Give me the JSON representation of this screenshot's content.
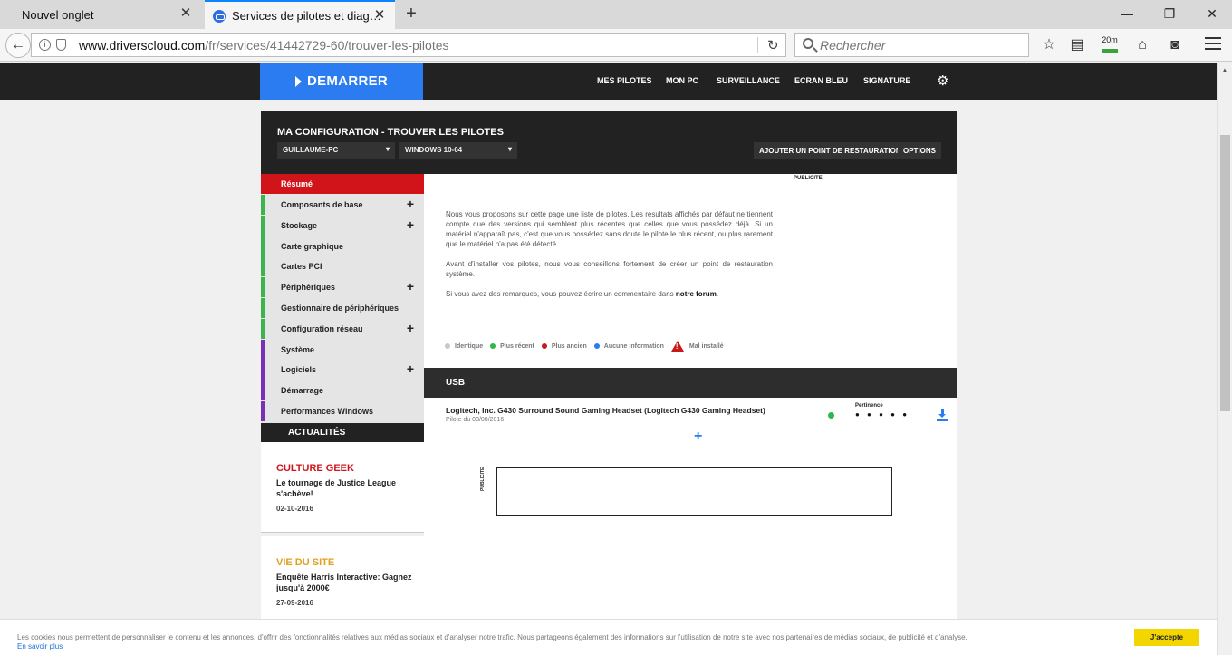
{
  "browser": {
    "tabs": [
      {
        "title": "Nouvel onglet"
      },
      {
        "title": "Services de pilotes et diag…"
      }
    ],
    "new_tab": "+",
    "url_domain": "www.driverscloud.com",
    "url_path": "/fr/services/41442729-60/trouver-les-pilotes",
    "search_placeholder": "Rechercher",
    "timer_badge": "20m"
  },
  "site_nav": {
    "start_label": "DEMARRER",
    "links": [
      "MES PILOTES",
      "MON PC",
      "SURVEILLANCE",
      "ECRAN BLEU",
      "SIGNATURE"
    ]
  },
  "config": {
    "title": "MA CONFIGURATION - TROUVER LES PILOTES",
    "pc_select": "GUILLAUME-PC",
    "os_select": "WINDOWS 10-64",
    "restore_button": "AJOUTER UN POINT DE RESTAURATION",
    "options_button": "OPTIONS"
  },
  "sidebar": {
    "items": [
      {
        "label": "Résumé"
      },
      {
        "label": "Composants de base"
      },
      {
        "label": "Stockage"
      },
      {
        "label": "Carte graphique"
      },
      {
        "label": "Cartes PCI"
      },
      {
        "label": "Périphériques"
      },
      {
        "label": "Gestionnaire de périphériques"
      },
      {
        "label": "Configuration réseau"
      },
      {
        "label": "Système"
      },
      {
        "label": "Logiciels"
      },
      {
        "label": "Démarrage"
      },
      {
        "label": "Performances Windows"
      }
    ],
    "plus": "+"
  },
  "news": {
    "header": "ACTUALITÉS",
    "items": [
      {
        "category": "CULTURE GEEK",
        "title": "Le tournage de Justice League s'achève!",
        "date": "02-10-2016",
        "color": "#d0141a"
      },
      {
        "category": "VIE DU SITE",
        "title": "Enquête Harris Interactive: Gagnez jusqu'à 2000€",
        "date": "27-09-2016",
        "color": "#e0a020"
      }
    ]
  },
  "main": {
    "pub_label": "PUBLICITE",
    "intro_1": "Nous vous proposons sur cette page une liste de pilotes. Les résultats affichés par défaut ne tiennent compte que des versions qui semblent plus récentes que celles que vous possédez déjà. Si un matériel n'apparaît pas, c'est que vous possédez sans doute le pilote le plus récent, ou plus rarement que le matériel n'a pas été détecté.",
    "intro_2": "Avant d'installer vos pilotes, nous vous conseillons fortement de créer un point de restauration système.",
    "intro_3_prefix": "Si vous avez des remarques, vous pouvez écrire un commentaire dans",
    "intro_3_link": "notre forum",
    "intro_3_suffix": ".",
    "legend": [
      {
        "label": "Identique",
        "color": "#c8c8c8"
      },
      {
        "label": "Plus récent",
        "color": "#2db84b"
      },
      {
        "label": "Plus ancien",
        "color": "#c81818"
      },
      {
        "label": "Aucune information",
        "color": "#2a7cf0"
      }
    ],
    "legend_warning": "Mal installé",
    "section_title": "USB",
    "driver": {
      "name": "Logitech, Inc. G430 Surround Sound Gaming Headset (Logitech G430 Gaming Headset)",
      "date": "Pilote du 03/08/2016",
      "pertinence_label": "Pertinence",
      "pertinence_dots": "● ● ● ● ●"
    },
    "expand": "+",
    "ad_label": "PUBLICITE"
  },
  "cookie": {
    "text": "Les cookies nous permettent de personnaliser le contenu et les annonces, d'offrir des fonctionnalités relatives aux médias sociaux et d'analyser notre trafic. Nous partageons également des informations sur l'utilisation de notre site avec nos partenaires de médias sociaux, de publicité et d'analyse.",
    "more": "En savoir plus",
    "accept": "J'accepte"
  }
}
